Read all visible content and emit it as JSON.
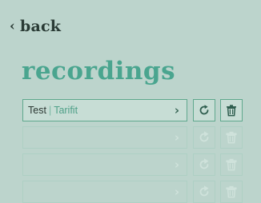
{
  "nav": {
    "back_label": "back",
    "back_icon": "chevron-left-icon"
  },
  "page": {
    "title": "recordings"
  },
  "recordings": [
    {
      "name": "Test",
      "separator": "|",
      "subtitle": "Tarifit",
      "empty": false
    },
    {
      "name": "",
      "separator": "",
      "subtitle": "",
      "empty": true
    },
    {
      "name": "",
      "separator": "",
      "subtitle": "",
      "empty": true
    },
    {
      "name": "",
      "separator": "",
      "subtitle": "",
      "empty": true
    }
  ],
  "icons": {
    "open": "chevron-right-icon",
    "reload": "reload-icon",
    "delete": "trash-icon"
  },
  "colors": {
    "background": "#bcd4cc",
    "accent": "#4aa58f",
    "text_dark": "#2a3b35",
    "border": "#5fa88d",
    "border_faded": "#aed0c4"
  }
}
